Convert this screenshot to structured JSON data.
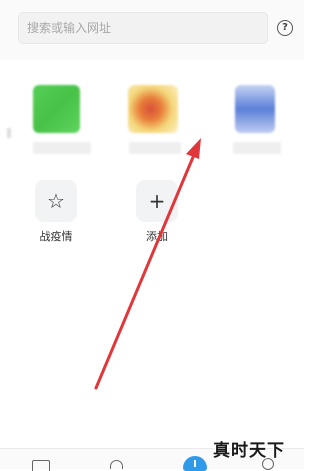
{
  "search": {
    "placeholder": "搜索或输入网址"
  },
  "help_icon": {
    "glyph": "?"
  },
  "shortcuts": [
    {
      "label": "战疫情",
      "icon": "star-icon",
      "glyph": "☆"
    },
    {
      "label": "添加",
      "icon": "plus-icon",
      "glyph": "+"
    }
  ],
  "bottom_nav": {
    "icons": [
      "tabs-icon",
      "user-icon",
      "cloud-icon",
      "profile-icon"
    ],
    "accent": "#2f9be8"
  },
  "annotation": {
    "arrow_color": "#e2373a"
  },
  "watermark": {
    "text": "真时天下"
  }
}
